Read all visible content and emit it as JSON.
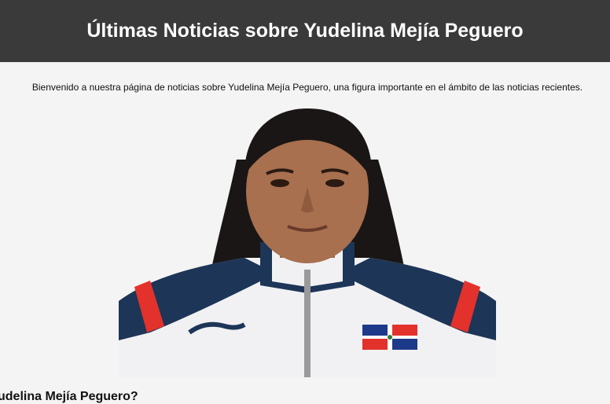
{
  "header": {
    "title": "Últimas Noticias sobre Yudelina Mejía Peguero"
  },
  "intro": {
    "text": "Bienvenido a nuestra página de noticias sobre Yudelina Mejía Peguero, una figura importante en el ámbito de las noticias recientes."
  },
  "photo": {
    "subject": "portrait-photo",
    "colors": {
      "jacket_white": "#f1f1f3",
      "jacket_navy": "#1d3557",
      "accent_red": "#e3322b",
      "skin": "#a8704f",
      "hair": "#1a1615"
    }
  },
  "section": {
    "heading": "udelina Mejía Peguero?"
  }
}
